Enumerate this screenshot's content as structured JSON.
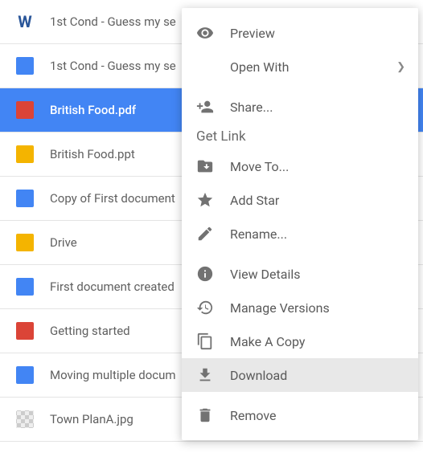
{
  "files": [
    {
      "name": "1st Cond - Guess my se",
      "icon": "word",
      "iconGlyph": "W"
    },
    {
      "name": "1st Cond - Guess my se",
      "icon": "gdoc",
      "iconGlyph": ""
    },
    {
      "name": "British Food.pdf",
      "icon": "pdf",
      "iconGlyph": "",
      "selected": true
    },
    {
      "name": "British Food.ppt",
      "icon": "gslide",
      "iconGlyph": ""
    },
    {
      "name": "Copy of First document",
      "icon": "gdoc",
      "iconGlyph": ""
    },
    {
      "name": "Drive",
      "icon": "gslide",
      "iconGlyph": ""
    },
    {
      "name": "First document created",
      "icon": "gdoc",
      "iconGlyph": ""
    },
    {
      "name": "Getting started",
      "icon": "pdf",
      "iconGlyph": ""
    },
    {
      "name": "Moving multiple docum",
      "icon": "gdoc",
      "iconGlyph": ""
    },
    {
      "name": "Town PlanA.jpg",
      "icon": "image",
      "iconGlyph": ""
    }
  ],
  "menu": {
    "preview": "Preview",
    "openWith": "Open With",
    "share": "Share...",
    "getLink": "Get Link",
    "moveTo": "Move To...",
    "addStar": "Add Star",
    "rename": "Rename...",
    "viewDetails": "View Details",
    "manageVersions": "Manage Versions",
    "makeACopy": "Make A Copy",
    "download": "Download",
    "remove": "Remove"
  }
}
